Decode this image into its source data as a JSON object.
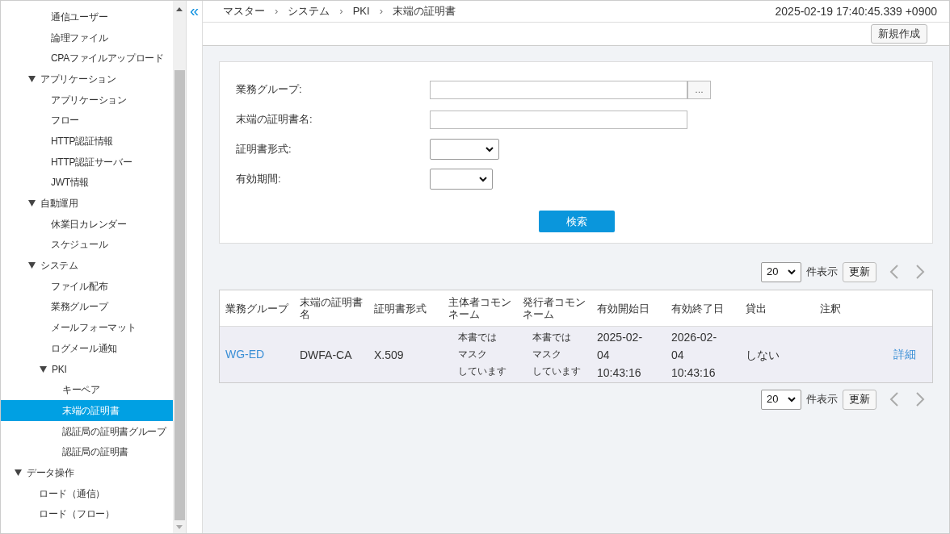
{
  "sidebar": {
    "items": [
      {
        "children": [
          {
            "children": [
              {
                "label": "通信ユーザー",
                "selected": false
              },
              {
                "label": "論理ファイル",
                "selected": false
              },
              {
                "label": "CPAファイルアップロード",
                "selected": false
              }
            ]
          },
          {
            "label": "アプリケーション",
            "expanded": true,
            "children": [
              {
                "label": "アプリケーション",
                "selected": false
              },
              {
                "label": "フロー",
                "selected": false
              },
              {
                "label": "HTTP認証情報",
                "selected": false
              },
              {
                "label": "HTTP認証サーバー",
                "selected": false
              },
              {
                "label": "JWT情報",
                "selected": false
              }
            ]
          },
          {
            "label": "自動運用",
            "expanded": true,
            "children": [
              {
                "label": "休業日カレンダー",
                "selected": false
              },
              {
                "label": "スケジュール",
                "selected": false
              }
            ]
          },
          {
            "label": "システム",
            "expanded": true,
            "children": [
              {
                "label": "ファイル配布",
                "selected": false
              },
              {
                "label": "業務グループ",
                "selected": false
              },
              {
                "label": "メールフォーマット",
                "selected": false
              },
              {
                "label": "ログメール通知",
                "selected": false
              },
              {
                "label": "PKI",
                "expanded": true,
                "children": [
                  {
                    "label": "キーペア",
                    "selected": false
                  },
                  {
                    "label": "末端の証明書",
                    "selected": true
                  },
                  {
                    "label": "認証局の証明書グループ",
                    "selected": false
                  },
                  {
                    "label": "認証局の証明書",
                    "selected": false
                  }
                ]
              }
            ]
          }
        ]
      },
      {
        "label": "データ操作",
        "expanded": true,
        "children": [
          {
            "label": "ロード（通信）",
            "selected": false
          },
          {
            "label": "ロード（フロー）",
            "selected": false
          }
        ]
      }
    ]
  },
  "collapse_button": "«",
  "breadcrumb": [
    "マスター",
    "システム",
    "PKI",
    "末端の証明書"
  ],
  "breadcrumb_separator": "›",
  "timestamp": "2025-02-19 17:40:45.339 +0900",
  "new_button": "新規作成",
  "search_form": {
    "fields": [
      {
        "kind": "picker",
        "label": "業務グループ:",
        "button": "…"
      },
      {
        "kind": "text",
        "label": "末端の証明書名:"
      },
      {
        "kind": "select",
        "label": "証明書形式:"
      },
      {
        "kind": "select_small",
        "label": "有効期間:"
      }
    ],
    "search_button": "検索"
  },
  "pager_top": {
    "page_size": "20",
    "per_page_label": "件表示",
    "refresh": "更新"
  },
  "table": {
    "columns": [
      "業務グループ",
      "末端の証明書名",
      "証明書形式",
      "主体者コモンネーム",
      "発行者コモンネーム",
      "有効開始日",
      "有効終了日",
      "貸出",
      "注釈"
    ],
    "rows": [
      {
        "cells": [
          "WG-ED",
          "DWFA-CA",
          "X.509",
          [
            "本書では",
            "マスク",
            "しています"
          ],
          [
            "本書では",
            "マスク",
            "しています"
          ],
          "2025-02-\n04\n10:43:16",
          "2026-02-\n04\n10:43:16",
          "しない"
        ],
        "action": "詳細"
      }
    ]
  },
  "pager_bottom": {
    "page_size": "20",
    "per_page_label": "件表示",
    "refresh": "更新"
  }
}
